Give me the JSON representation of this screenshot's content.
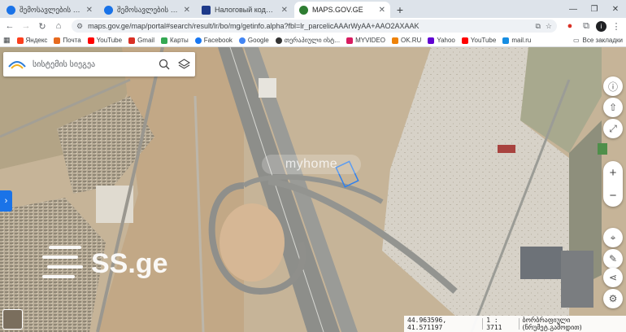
{
  "browser": {
    "tabs": [
      {
        "title": "შემოსავლების სამსახური",
        "favicon_color": "#1a73e8"
      },
      {
        "title": "შემოსავლების სამსახური",
        "favicon_color": "#1a73e8"
      },
      {
        "title": "Налоговый кодекс Грузии | Ма",
        "favicon_color": "#1e3a8a"
      },
      {
        "title": "MAPS.GOV.GE",
        "favicon_color": "#2e7d32"
      }
    ],
    "active_tab": 3,
    "url": "maps.gov.ge/map/portal#search/result/lr/bo/mg/getinfo.alpha?fbl=lr_parcelicAAArWyAA+AAO2AXAAK",
    "profile_initial": "i",
    "bookmarks": [
      {
        "label": "Яндекс",
        "color": "#fc3f1d"
      },
      {
        "label": "Почта",
        "color": "#e66a1e"
      },
      {
        "label": "YouTube",
        "color": "#ff0000"
      },
      {
        "label": "Gmail",
        "color": "#d93025"
      },
      {
        "label": "Карты",
        "color": "#34a853"
      },
      {
        "label": "Facebook",
        "color": "#1877f2"
      },
      {
        "label": "Google",
        "color": "#4285f4"
      },
      {
        "label": "თერაპიული ისტ...",
        "color": "#333333"
      },
      {
        "label": "MYVIDEO",
        "color": "#d81b60"
      },
      {
        "label": "OK.RU",
        "color": "#ee8208"
      },
      {
        "label": "Yahoo",
        "color": "#6001d2"
      },
      {
        "label": "YouTube",
        "color": "#ff0000"
      },
      {
        "label": "mail.ru",
        "color": "#168de2"
      }
    ],
    "all_bookmarks_label": "Все закладки"
  },
  "map": {
    "search_placeholder": "სისტემის სიეგეა",
    "watermark_myhome": "myhome",
    "watermark_ss": "SS.ge",
    "coordinates": "44.963596, 41.571197",
    "scale": "1 : 3711",
    "layer_label": "ბორბრაფიული (ნრუმეტ.გამოდით)",
    "controls": {
      "zoom_in": "+",
      "zoom_out": "−"
    }
  },
  "colors": {
    "accent": "#1a73e8",
    "tab_strip": "#dde3ea"
  }
}
